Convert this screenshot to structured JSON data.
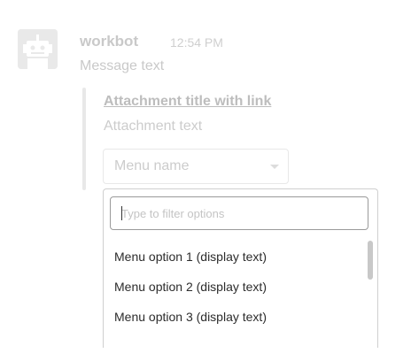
{
  "message": {
    "sender": "workbot",
    "timestamp": "12:54 PM",
    "text": "Message text"
  },
  "attachment": {
    "title": "Attachment title with link",
    "text": "Attachment text",
    "menu": {
      "label": "Menu name"
    }
  },
  "dropdown": {
    "filter_placeholder": "Type to filter options",
    "filter_value": "",
    "options": [
      {
        "label": "Menu option 1 (display text)"
      },
      {
        "label": "Menu option 2 (display text)"
      },
      {
        "label": "Menu option 3 (display text)"
      }
    ]
  },
  "icons": {
    "avatar": "robot-icon",
    "menu_caret": "chevron-down-icon"
  },
  "colors": {
    "avatar_background": "#e9e9e9",
    "muted_text": "#c9c9c9",
    "attachment_bar": "#e8e8e8",
    "dropdown_border": "#cfcfcf",
    "option_text": "#2c2c2c"
  }
}
